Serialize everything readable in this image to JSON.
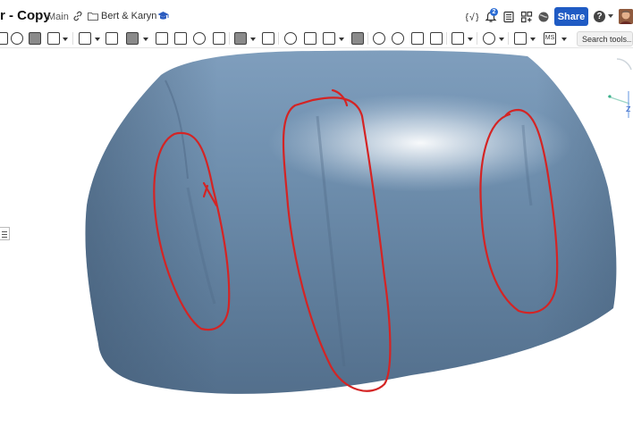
{
  "document": {
    "title": "r - Copy",
    "branch": "Main",
    "folder": "Bert & Karyn"
  },
  "topbar": {
    "notifications_count": "2",
    "share_label": "Share",
    "help_label": "?"
  },
  "toolbar": {
    "search_placeholder": "Search tools...",
    "ms_label": "MS"
  },
  "viewport": {
    "model_color": "#6f8fae",
    "annotation_color": "#d42424",
    "axis_labels": {
      "z": "Z"
    }
  },
  "colors": {
    "accent": "#1f5bc4",
    "badge": "#2b6cd4"
  }
}
